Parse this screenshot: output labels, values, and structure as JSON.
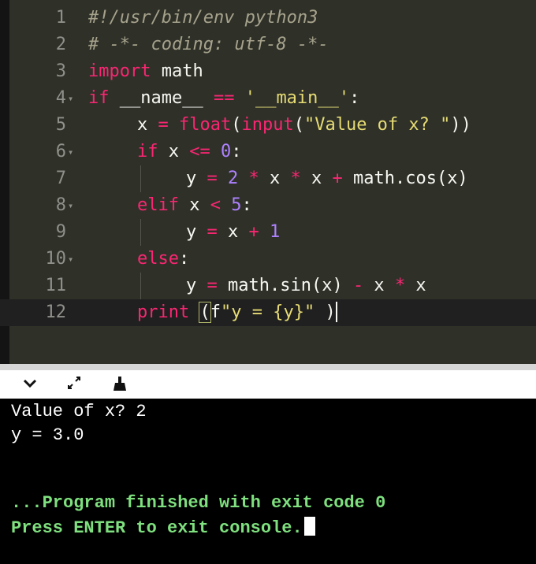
{
  "editor": {
    "lines": [
      {
        "num": "1",
        "tokens": [
          {
            "t": "#!/usr/bin/env python3",
            "c": "c-com"
          }
        ]
      },
      {
        "num": "2",
        "tokens": [
          {
            "t": "# -*- coding: utf-8 -*-",
            "c": "c-com"
          }
        ]
      },
      {
        "num": "3",
        "tokens": [
          {
            "t": "import",
            "c": "c-kw"
          },
          {
            "t": " math",
            "c": ""
          }
        ]
      },
      {
        "num": "4",
        "fold": true,
        "tokens": [
          {
            "t": "if",
            "c": "c-kw"
          },
          {
            "t": " __name__ ",
            "c": ""
          },
          {
            "t": "==",
            "c": "c-kw"
          },
          {
            "t": " ",
            "c": ""
          },
          {
            "t": "'__main__'",
            "c": "c-str"
          },
          {
            "t": ":",
            "c": ""
          }
        ]
      },
      {
        "num": "5",
        "indent": 1,
        "tokens": [
          {
            "t": "x ",
            "c": ""
          },
          {
            "t": "=",
            "c": "c-kw"
          },
          {
            "t": " ",
            "c": ""
          },
          {
            "t": "float",
            "c": "c-fn"
          },
          {
            "t": "(",
            "c": ""
          },
          {
            "t": "input",
            "c": "c-fn"
          },
          {
            "t": "(",
            "c": ""
          },
          {
            "t": "\"Value of x? \"",
            "c": "c-str"
          },
          {
            "t": "))",
            "c": ""
          }
        ]
      },
      {
        "num": "6",
        "fold": true,
        "indent": 1,
        "tokens": [
          {
            "t": "if",
            "c": "c-kw"
          },
          {
            "t": " x ",
            "c": ""
          },
          {
            "t": "<=",
            "c": "c-kw"
          },
          {
            "t": " ",
            "c": ""
          },
          {
            "t": "0",
            "c": "c-num"
          },
          {
            "t": ":",
            "c": ""
          }
        ]
      },
      {
        "num": "7",
        "indent": 2,
        "guide": true,
        "tokens": [
          {
            "t": "y ",
            "c": ""
          },
          {
            "t": "=",
            "c": "c-kw"
          },
          {
            "t": " ",
            "c": ""
          },
          {
            "t": "2",
            "c": "c-num"
          },
          {
            "t": " ",
            "c": ""
          },
          {
            "t": "*",
            "c": "c-kw"
          },
          {
            "t": " x ",
            "c": ""
          },
          {
            "t": "*",
            "c": "c-kw"
          },
          {
            "t": " x ",
            "c": ""
          },
          {
            "t": "+",
            "c": "c-kw"
          },
          {
            "t": " math.cos(x)",
            "c": ""
          }
        ]
      },
      {
        "num": "8",
        "fold": true,
        "indent": 1,
        "tokens": [
          {
            "t": "elif",
            "c": "c-kw"
          },
          {
            "t": " x ",
            "c": ""
          },
          {
            "t": "<",
            "c": "c-kw"
          },
          {
            "t": " ",
            "c": ""
          },
          {
            "t": "5",
            "c": "c-num"
          },
          {
            "t": ":",
            "c": ""
          }
        ]
      },
      {
        "num": "9",
        "indent": 2,
        "guide": true,
        "tokens": [
          {
            "t": "y ",
            "c": ""
          },
          {
            "t": "=",
            "c": "c-kw"
          },
          {
            "t": " x ",
            "c": ""
          },
          {
            "t": "+",
            "c": "c-kw"
          },
          {
            "t": " ",
            "c": ""
          },
          {
            "t": "1",
            "c": "c-num"
          }
        ]
      },
      {
        "num": "10",
        "fold": true,
        "indent": 1,
        "tokens": [
          {
            "t": "else",
            "c": "c-kw"
          },
          {
            "t": ":",
            "c": ""
          }
        ]
      },
      {
        "num": "11",
        "indent": 2,
        "guide": true,
        "tokens": [
          {
            "t": "y ",
            "c": ""
          },
          {
            "t": "=",
            "c": "c-kw"
          },
          {
            "t": " math.sin(x) ",
            "c": ""
          },
          {
            "t": "-",
            "c": "c-kw"
          },
          {
            "t": " x ",
            "c": ""
          },
          {
            "t": "*",
            "c": "c-kw"
          },
          {
            "t": " x",
            "c": ""
          }
        ]
      },
      {
        "num": "12",
        "active": true,
        "indent": 1,
        "tokens": [
          {
            "t": "print",
            "c": "c-kw"
          },
          {
            "t": " ",
            "c": ""
          },
          {
            "t": "(",
            "c": "bracket-hl"
          },
          {
            "t": "f",
            "c": ""
          },
          {
            "t": "\"y = {y}\"",
            "c": "c-str"
          },
          {
            "t": " )",
            "c": ""
          }
        ],
        "cursor": true
      }
    ]
  },
  "toolbar": {
    "collapse_icon": "chevron-down-icon",
    "expand_icon": "expand-arrows-icon",
    "clear_icon": "broom-icon",
    "collapse_glyph": "⌄",
    "expand_glyph": "⤢",
    "clear_glyph": "⌂"
  },
  "console": {
    "line1": "Value of x? 2",
    "line2": "y = 3.0",
    "line3": "",
    "line4": "...Program finished with exit code 0",
    "line5": "Press ENTER to exit console."
  },
  "colors": {
    "editor_bg": "#2f3129",
    "keyword": "#f92672",
    "string": "#e6db74",
    "number": "#ae81ff",
    "comment": "#a6a28c",
    "console_green": "#7ee07e"
  }
}
